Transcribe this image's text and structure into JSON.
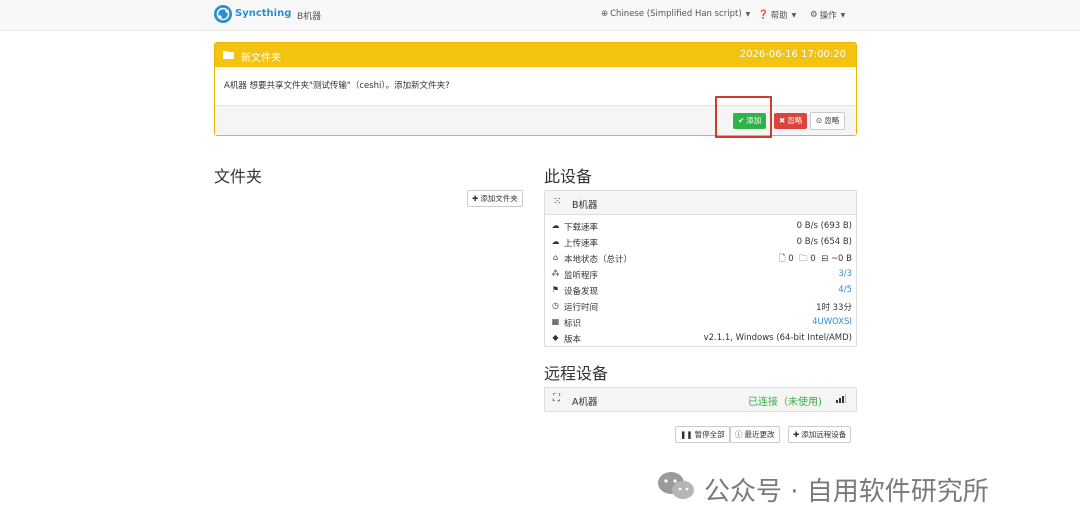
{
  "navbar": {
    "brand": "Syncthing",
    "device_name": "B机器",
    "language": "Chinese (Simplified Han script)",
    "help": "帮助",
    "actions": "操作"
  },
  "notification": {
    "title": "新文件夹",
    "date": "2026-06-16 17:00:20",
    "message": "A机器 想要共享文件夹\"测试传输\"（ceshi）。添加新文件夹?",
    "add_label": "添加",
    "decline_label": "忽略",
    "ignore_label": "忽略"
  },
  "folders": {
    "title": "文件夹",
    "add_folder_label": "添加文件夹"
  },
  "this_device": {
    "title": "此设备",
    "name": "B机器",
    "rows": [
      {
        "icon": "cloud-download-icon",
        "label": "下载速率",
        "value": "0 B/s (693 B)"
      },
      {
        "icon": "cloud-upload-icon",
        "label": "上传速率",
        "value": "0 B/s (654 B)"
      },
      {
        "icon": "home-icon",
        "label": "本地状态（总计）",
        "value": ""
      },
      {
        "icon": "sitemap-icon",
        "label": "监听程序",
        "value": "3/3"
      },
      {
        "icon": "signpost-icon",
        "label": "设备发现",
        "value": "4/5"
      },
      {
        "icon": "clock-icon",
        "label": "运行时间",
        "value": "1时 33分"
      },
      {
        "icon": "qrcode-icon",
        "label": "标识",
        "value": "4UWOXSI"
      },
      {
        "icon": "tag-icon",
        "label": "版本",
        "value": "v2.1.1, Windows (64-bit Intel/AMD)"
      }
    ],
    "local_state": {
      "files": "0",
      "dirs": "0",
      "size": "~0 B"
    }
  },
  "remote_devices": {
    "title": "远程设备",
    "device_name": "A机器",
    "status": "已连接（未使用)",
    "pause_all_label": "暂停全部",
    "recent_changes_label": "最近更改",
    "add_remote_label": "添加远程设备"
  },
  "watermark": {
    "text": "公众号 · 自用软件研究所"
  },
  "colors": {
    "brand": "#2b8fcf",
    "notification_header": "#f2c311",
    "add_button": "#2fb34a",
    "decline_button": "#d9453c",
    "connected": "#3cae43",
    "highlight_box": "#d43a2a"
  }
}
